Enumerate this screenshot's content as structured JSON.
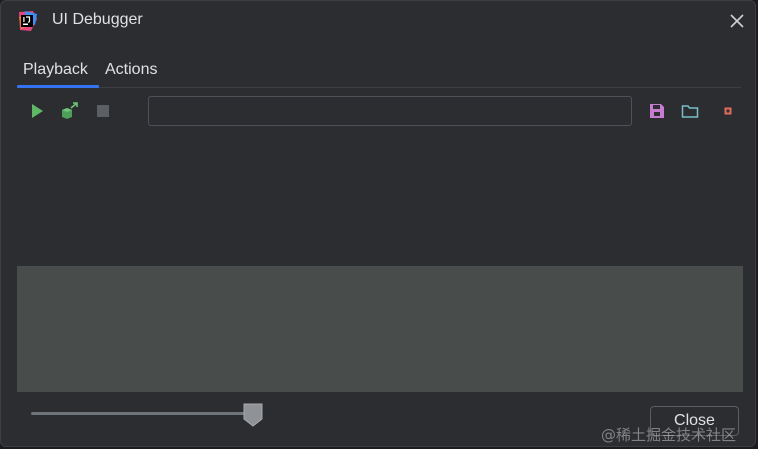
{
  "window": {
    "title": "UI Debugger",
    "close_icon": "close-icon"
  },
  "tabs": [
    {
      "label": "Playback",
      "selected": true
    },
    {
      "label": "Actions",
      "selected": false
    }
  ],
  "toolbar": {
    "play_icon": "play-icon",
    "record_icon": "cube-arrow-icon",
    "stop_icon": "stop-icon",
    "script_value": "",
    "save_icon": "save-icon",
    "open_icon": "folder-icon",
    "clear_icon": "clear-icon"
  },
  "slider": {
    "value_fraction": 0.96
  },
  "footer": {
    "close_label": "Close"
  },
  "watermark": "@稀土掘金技术社区",
  "colors": {
    "accent": "#3574f0",
    "play": "#5fb865",
    "save": "#c77dcf",
    "folder": "#7bbdc8",
    "clear": "#e06c5a",
    "log_background": "#484d4c"
  }
}
